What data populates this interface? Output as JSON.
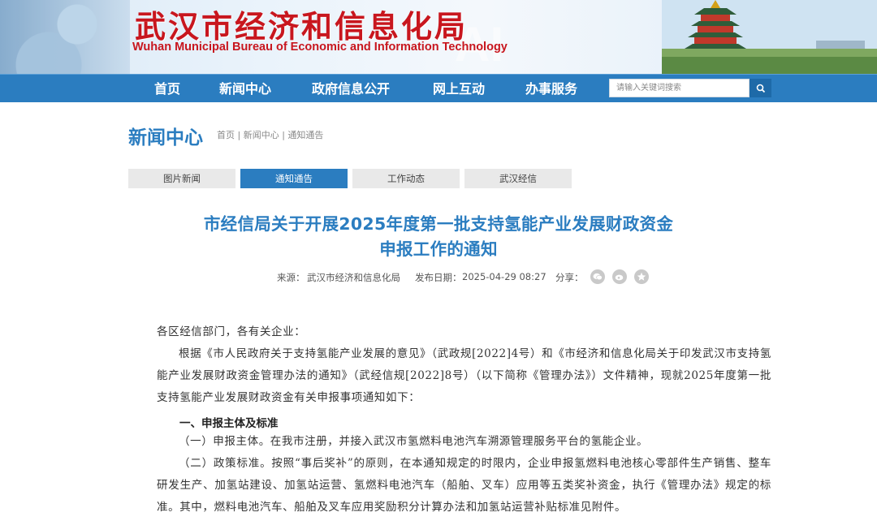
{
  "header": {
    "title_cn": "武汉市经济和信息化局",
    "title_en": "Wuhan Municipal Bureau of Economic and Information Technology",
    "decor_text": "AI"
  },
  "nav": {
    "items": [
      {
        "label": "首页"
      },
      {
        "label": "新闻中心"
      },
      {
        "label": "政府信息公开"
      },
      {
        "label": "网上互动"
      },
      {
        "label": "办事服务"
      }
    ],
    "search": {
      "placeholder": "请输入关键词搜索",
      "icon": "search-icon"
    }
  },
  "section": {
    "title": "新闻中心",
    "breadcrumb": [
      "首页",
      "新闻中心",
      "通知通告"
    ],
    "breadcrumb_sep": " | "
  },
  "tabs": [
    {
      "label": "图片新闻",
      "active": false
    },
    {
      "label": "通知通告",
      "active": true
    },
    {
      "label": "工作动态",
      "active": false
    },
    {
      "label": "武汉经信",
      "active": false
    }
  ],
  "article": {
    "title_line1": "市经信局关于开展2025年度第一批支持氢能产业发展财政资金",
    "title_line2": "申报工作的通知",
    "source_label": "来源：",
    "source": "武汉市经济和信息化局",
    "date_label": "发布日期：",
    "date": "2025-04-29 08:27",
    "share_label": "分享：",
    "share_icons": [
      "wechat-icon",
      "weibo-icon",
      "qzone-icon"
    ],
    "salutation": "各区经信部门，各有关企业：",
    "p1": "根据《市人民政府关于支持氢能产业发展的意见》（武政规[2022]4号）和《市经济和信息化局关于印发武汉市支持氢能产业发展财政资金管理办法的通知》（武经信规[2022]8号）（以下简称《管理办法》）文件精神，现就2025年度第一批支持氢能产业发展财政资金有关申报事项通知如下：",
    "h1": "一、申报主体及标准",
    "p2": "（一）申报主体。在我市注册，并接入武汉市氢燃料电池汽车溯源管理服务平台的氢能企业。",
    "p3": "（二）政策标准。按照“事后奖补”的原则，在本通知规定的时限内，企业申报氢燃料电池核心零部件生产销售、整车研发生产、加氢站建设、加氢站运营、氢燃料电池汽车（船舶、叉车）应用等五类奖补资金，执行《管理办法》规定的标准。其中，燃料电池汽车、船舶及叉车应用奖励积分计算办法和加氢站运营补贴标准见附件。"
  },
  "colors": {
    "brand_blue": "#2b7dc0",
    "title_red": "#c8161e",
    "tab_gray": "#e9e9e9"
  }
}
